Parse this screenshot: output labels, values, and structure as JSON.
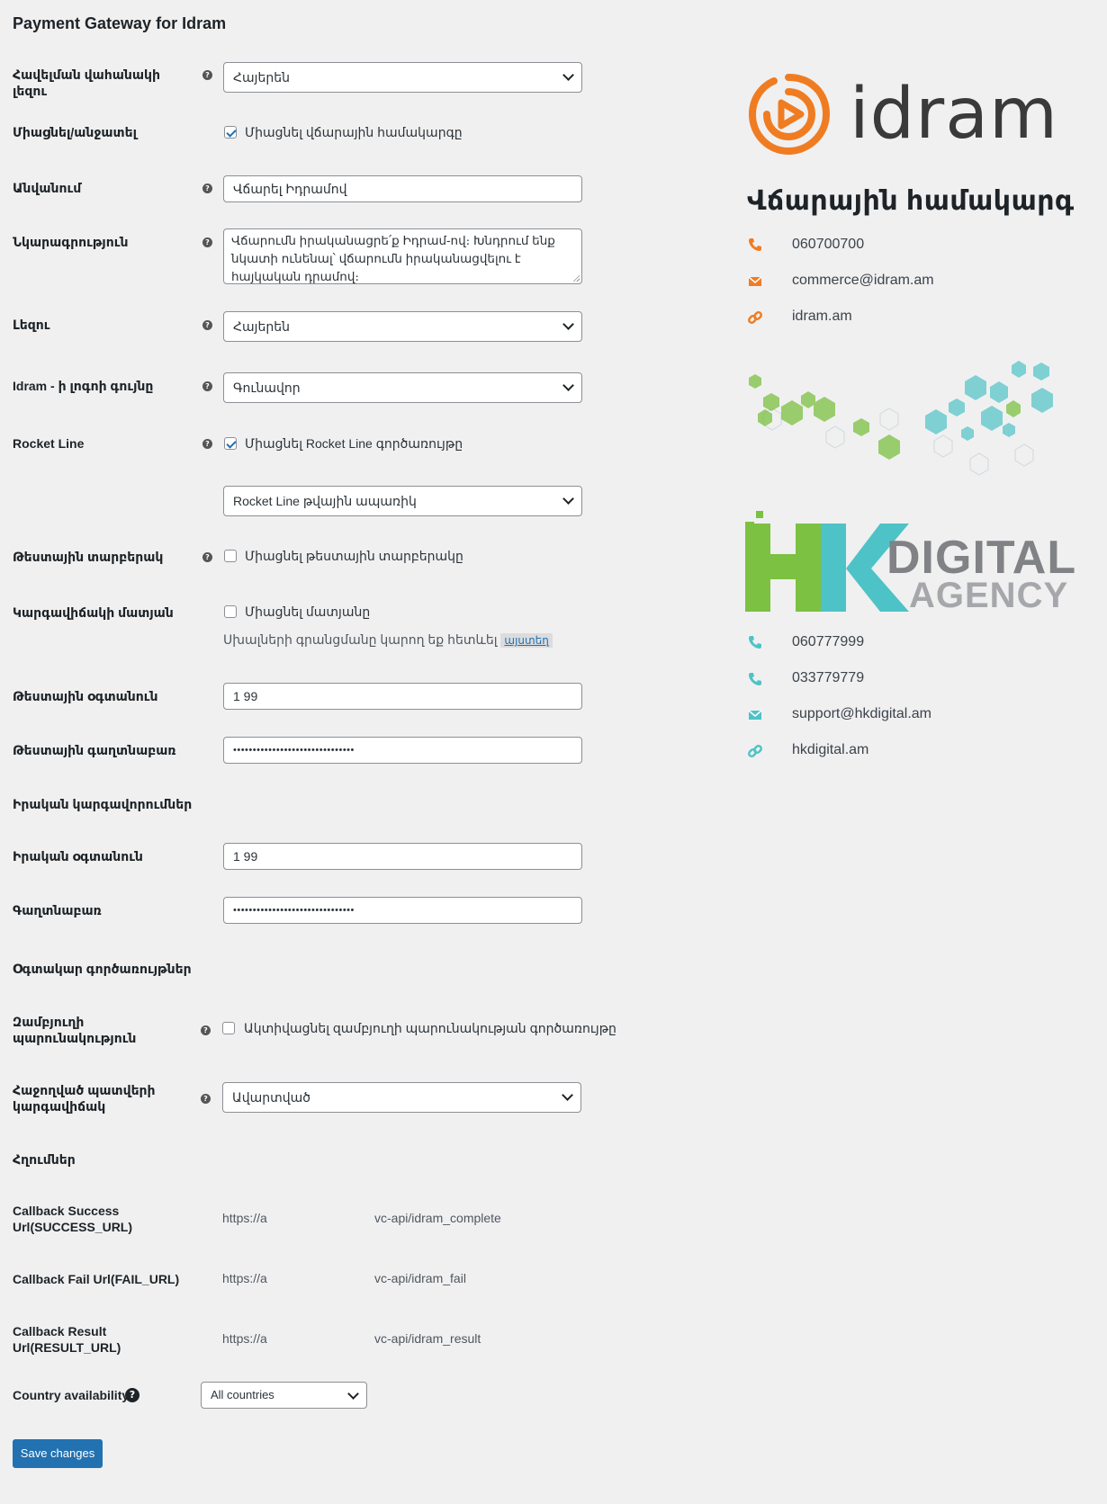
{
  "page": {
    "title": "Payment Gateway for Idram"
  },
  "fields": {
    "checkout_lang": {
      "label": "Հավելման վահանակի լեզու",
      "value": "Հայերեն"
    },
    "enable": {
      "label": "Միացնել/անջատել",
      "checkbox_label": "Միացնել վճարային համակարգը",
      "checked": true
    },
    "title": {
      "label": "Անվանում",
      "value": "Վճարել Իդրամով"
    },
    "description": {
      "label": "Նկարագրություն",
      "value": "Վճարումն իրականացրե՛ք Իդրամ-ով։ Խնդրում ենք նկատի ունենալ՝ վճարումն իրականացվելու է հայկական դրամով։"
    },
    "language": {
      "label": "Լեզու",
      "value": "Հայերեն"
    },
    "logo_color": {
      "label": "Idram - ի լոգոի գույնը",
      "value": "Գունավոր"
    },
    "rocket_line": {
      "label": "Rocket Line",
      "checkbox_label": "Միացնել Rocket Line գործառույթը",
      "checked": true,
      "select_value": "Rocket Line թվային ապառիկ"
    },
    "test_mode": {
      "label": "Թեստային տարբերակ",
      "checkbox_label": "Միացնել թեստային տարբերակը",
      "checked": false
    },
    "debug_log": {
      "label": "Կարգավիճակի մատյան",
      "checkbox_label": "Միացնել մատյանը",
      "checked": false,
      "note": "Սխալների գրանցմանը կարող եք հետևել",
      "link": "այստեղ"
    },
    "test_user": {
      "label": "Թեստային օգտանուն",
      "value": "1            99"
    },
    "test_pass": {
      "label": "Թեստային գաղտնաբառ",
      "value": "•••••••••••••••••••••••••••••••"
    },
    "live_section": {
      "label": "Իրական կարգավորումներ"
    },
    "live_user": {
      "label": "Իրական օգտանուն",
      "value": "1            99"
    },
    "live_pass": {
      "label": "Գաղտնաբառ",
      "value": "•••••••••••••••••••••••••••••••"
    },
    "useful_section": {
      "label": "Օգտակար գործառույթներ"
    },
    "multi_site": {
      "label": "Զամբյուղի պարունակություն",
      "label_line1": "Զամբյուղի",
      "label_line2": "պարունակություն",
      "checkbox_label": "Ակտիվացնել զամբյուղի պարունակության գործառույթը",
      "checked": false
    },
    "order_status": {
      "label_line1": "Հաջողված պատվերի",
      "label_line2": "կարգավիճակ",
      "value": "Ավարտված"
    },
    "links_section": {
      "label": "Հղումներ"
    },
    "success_url": {
      "label_line1": "Callback Success",
      "label_line2": "Url(SUCCESS_URL)",
      "value_start": "https://a",
      "value_end": "vc-api/idram_complete"
    },
    "fail_url": {
      "label": "Callback Fail Url(FAIL_URL)",
      "value_start": "https://a",
      "value_end": "vc-api/idram_fail"
    },
    "result_url": {
      "label_line1": "Callback Result",
      "label_line2": "Url(RESULT_URL)",
      "value_start": "https://a",
      "value_end": "vc-api/idram_result"
    },
    "country": {
      "label": "Country availability",
      "value": "All countries"
    }
  },
  "save_button": "Save changes",
  "sidebar": {
    "idram_logo_text": "idram",
    "heading": "Վճարային համակարգ",
    "idram_contacts": [
      {
        "icon": "phone-icon",
        "text": "060700700"
      },
      {
        "icon": "envelope-icon",
        "text": "commerce@idram.am"
      },
      {
        "icon": "link-icon",
        "text": "idram.am"
      }
    ],
    "hk_logo_text": {
      "letters": "HK",
      "line1": "DIGITAL",
      "line2": "AGENCY"
    },
    "hk_contacts": [
      {
        "icon": "phone-icon",
        "text": "060777999"
      },
      {
        "icon": "phone-icon",
        "text": "033779779"
      },
      {
        "icon": "envelope-icon",
        "text": "support@hkdigital.am"
      },
      {
        "icon": "link-icon",
        "text": "hkdigital.am"
      }
    ]
  },
  "colors": {
    "idram_orange": "#f07c22",
    "hk_green": "#7cc142",
    "hk_teal": "#4ec3c7",
    "hk_gray": "#8a8a8a",
    "primary_button": "#2271b1"
  }
}
